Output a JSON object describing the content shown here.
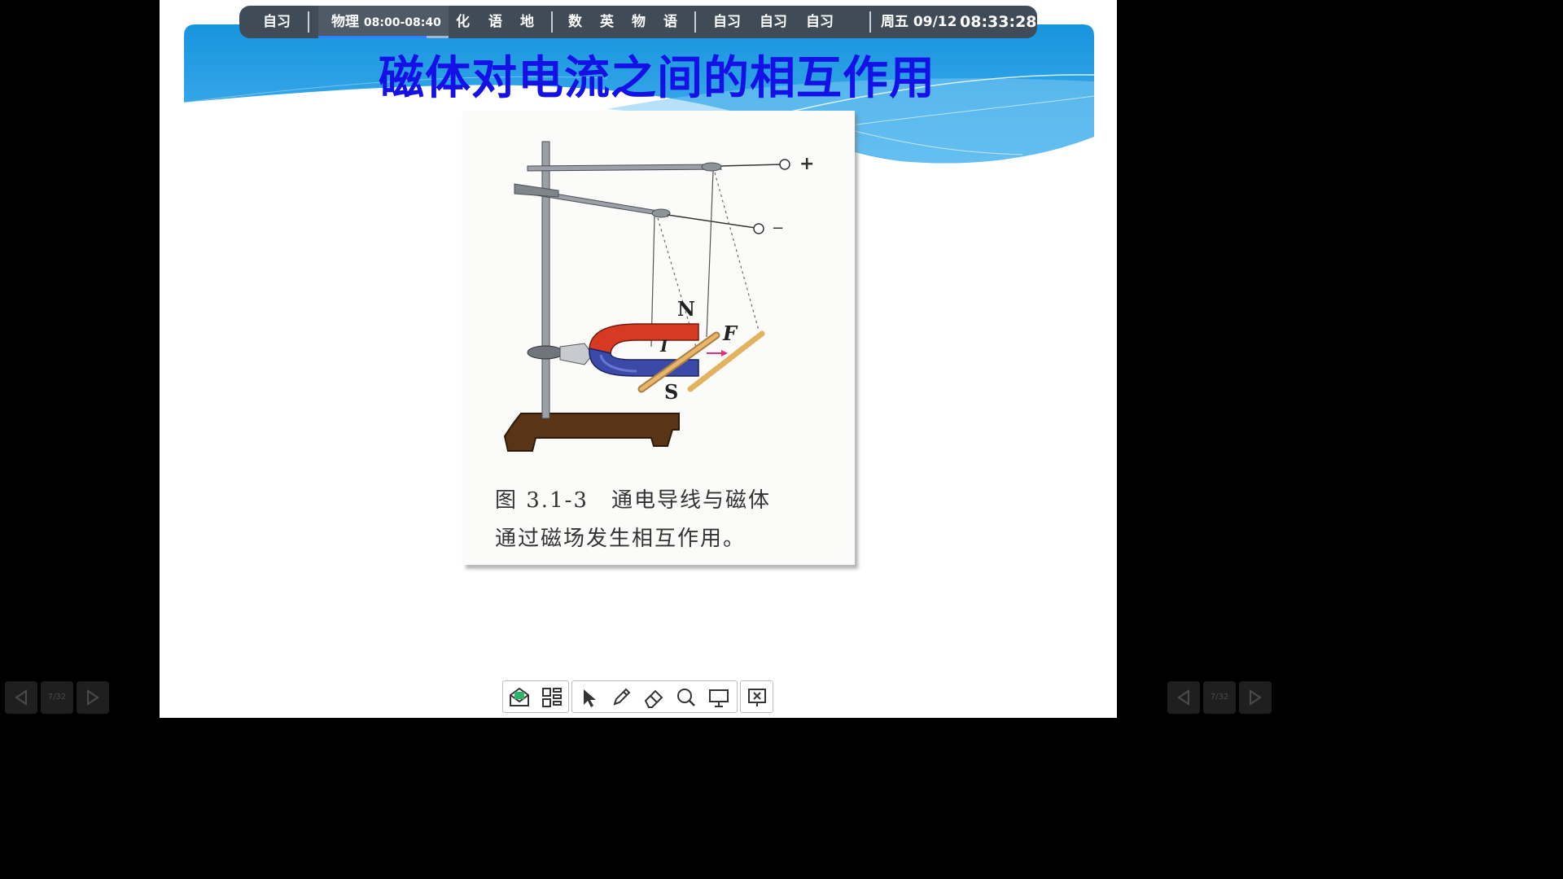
{
  "schedule": {
    "items": [
      "自习",
      "物理",
      "化",
      "语",
      "地",
      "数",
      "英",
      "物",
      "语",
      "自习",
      "自习",
      "自习"
    ],
    "active_time": "08:00-08:40",
    "active_progress": 0.83,
    "date": "周五 09/12",
    "clock": "08:33:28"
  },
  "slide": {
    "title": "磁体对电流之间的相互作用",
    "figure": {
      "caption_line1": "图 3.1-3　通电导线与磁体",
      "caption_line2": "通过磁场发生相互作用。",
      "labels": {
        "plus": "+",
        "minus": "−",
        "n_pole": "N",
        "s_pole": "S",
        "force": "F",
        "current": "I"
      }
    }
  },
  "nav": {
    "left_page": "7/32",
    "right_page": "7/32"
  },
  "toolbar": {
    "icons": [
      "mail-icon",
      "apps-grid-icon",
      "pointer-icon",
      "pen-icon",
      "eraser-icon",
      "search-icon",
      "screen-icon",
      "close-presentation-icon"
    ]
  },
  "colors": {
    "title": "#1510e6",
    "banner": "#1a9be0",
    "schedule_bg": "#3f4b57",
    "accent": "#2f80ff"
  }
}
